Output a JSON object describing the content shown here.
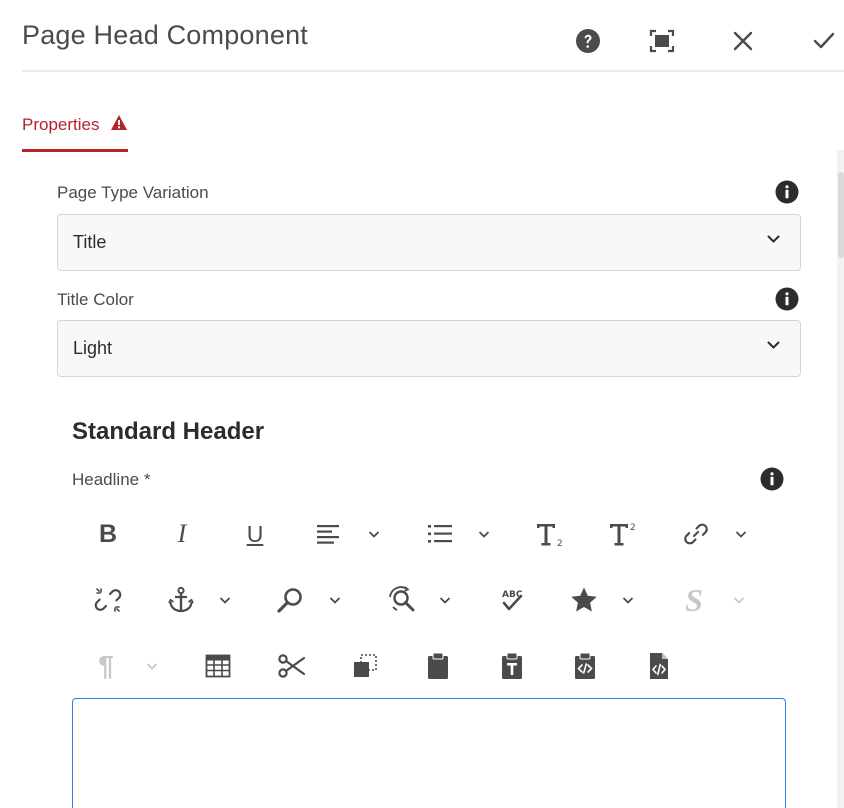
{
  "dialog": {
    "title": "Page Head Component",
    "buttons": {
      "help": "help-icon",
      "fullscreen": "fullscreen-icon",
      "close": "close-icon",
      "done": "checkmark-icon"
    }
  },
  "tabs": [
    {
      "label": "Properties",
      "alert_icon": "alert-icon",
      "active": true
    }
  ],
  "fields": {
    "page_type": {
      "label": "Page Type Variation",
      "value": "Title"
    },
    "title_color": {
      "label": "Title Color",
      "value": "Light"
    }
  },
  "section": {
    "heading": "Standard Header",
    "headline_label": "Headline *"
  },
  "toolbar": {
    "row1": [
      "bold",
      "italic",
      "underline",
      "justify",
      "list",
      "subscript",
      "superscript",
      "link"
    ],
    "row2": [
      "unlink",
      "anchor",
      "find",
      "replace",
      "spellcheck",
      "special-chars",
      "styles"
    ],
    "row3": [
      "paragraph-format",
      "table",
      "cut",
      "copy",
      "paste",
      "paste-as-text",
      "paste-wordhtml",
      "source-edit"
    ],
    "glyphs": {
      "bold": "B",
      "italic": "I",
      "underline": "U",
      "styles": "S",
      "paragraph": "¶"
    }
  },
  "colors": {
    "accent": "#b3242a",
    "icon": "#4b4b4b",
    "focus": "#2680eb",
    "disabled": "#c8c8c8"
  }
}
